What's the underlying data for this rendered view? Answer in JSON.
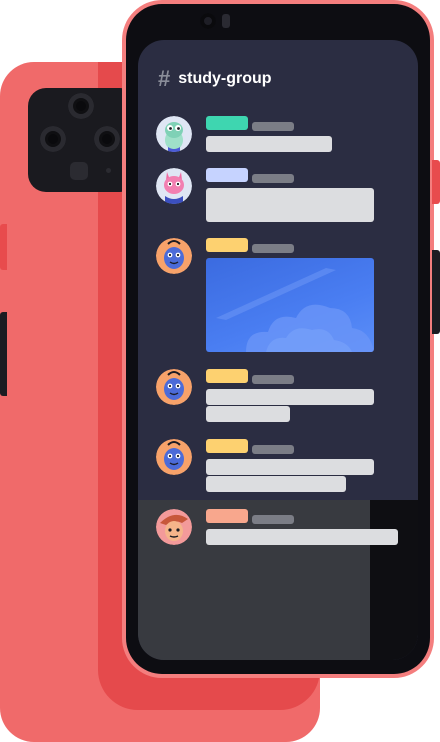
{
  "channel": {
    "hash_symbol": "#",
    "name": "study-group"
  },
  "colors": {
    "back_phone": "#f06a6a",
    "front_phone": "#f47e7e",
    "screen_bg": "#2b2d42",
    "name_green": "#3ed6b0",
    "name_blue": "#c6d3ff",
    "name_yellow": "#fdd170",
    "name_salmon": "#f8a78d",
    "text_placeholder": "#dcdde0",
    "time_placeholder": "#7b7d86"
  },
  "messages": [
    {
      "avatar": "green-character-avatar-icon",
      "name_color": "#3ed6b0",
      "lines": 1,
      "has_image": false
    },
    {
      "avatar": "pink-character-avatar-icon",
      "name_color": "#c6d3ff",
      "lines": 2,
      "has_image": false
    },
    {
      "avatar": "blue-character-avatar-icon",
      "name_color": "#fdd170",
      "lines": 0,
      "has_image": true
    },
    {
      "avatar": "blue-character-avatar-icon",
      "name_color": "#fdd170",
      "lines": 2,
      "has_image": false
    },
    {
      "avatar": "blue-character-avatar-icon",
      "name_color": "#fdd170",
      "lines": 2,
      "has_image": false
    },
    {
      "avatar": "orange-character-avatar-icon",
      "name_color": "#f8a78d",
      "lines": 1,
      "has_image": false
    }
  ]
}
